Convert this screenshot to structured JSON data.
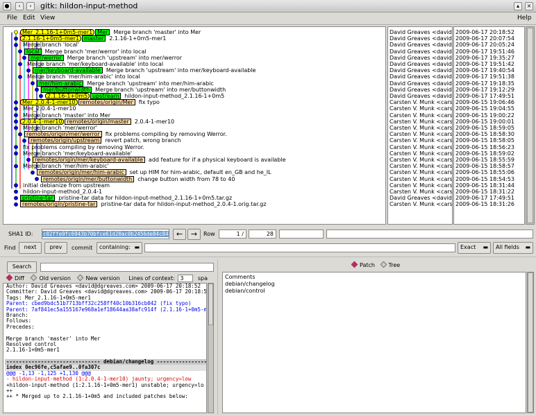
{
  "window": {
    "title": "gitk: hildon-input-method"
  },
  "menu": {
    "file": "File",
    "edit": "Edit",
    "view": "View",
    "help": "Help"
  },
  "commits": [
    {
      "refs": [
        {
          "label": "Mer_2.1.16-1+0m5-mer1",
          "kind": "tag"
        },
        {
          "label": "Mer",
          "kind": "head"
        }
      ],
      "msg": "Merge branch 'master' into Mer",
      "author": "David Greaves <david@",
      "date": "2009-06-17 20:18:52"
    },
    {
      "refs": [
        {
          "label": "2.1.16-1+0m5-mer1",
          "kind": "tag"
        },
        {
          "label": "master",
          "kind": "head"
        }
      ],
      "msg": "2.1.16-1+0m5-mer1",
      "author": "David Greaves <david@",
      "date": "2009-06-17 20:07:54"
    },
    {
      "refs": [],
      "msg": "Merge branch 'local'",
      "author": "David Greaves <david@",
      "date": "2009-06-17 20:05:24"
    },
    {
      "refs": [
        {
          "label": "local",
          "kind": "head"
        }
      ],
      "msg": "Merge branch 'mer/werror' into local",
      "author": "David Greaves <david@",
      "date": "2009-06-17 19:51:46"
    },
    {
      "refs": [
        {
          "label": "mer/werror",
          "kind": "head"
        }
      ],
      "msg": "Merge branch 'upstream' into mer/werror",
      "author": "David Greaves <david@",
      "date": "2009-06-17 19:35:27"
    },
    {
      "refs": [],
      "msg": "Merge branch 'mer/keyboard-available' into local",
      "author": "David Greaves <david@",
      "date": "2009-06-17 19:51:42"
    },
    {
      "refs": [
        {
          "label": "mer/keyboard-available",
          "kind": "head"
        }
      ],
      "msg": "Merge branch 'upstream' into mer/keyboard-available",
      "author": "David Greaves <david@",
      "date": "2009-06-17 19:40:54"
    },
    {
      "refs": [],
      "msg": "Merge branch 'mer/him-arabic' into local",
      "author": "David Greaves <david@",
      "date": "2009-06-17 19:51:38"
    },
    {
      "refs": [
        {
          "label": "mer/him-arabic",
          "kind": "head"
        }
      ],
      "msg": "Merge branch 'upstream' into mer/him-arabic",
      "author": "David Greaves <david@",
      "date": "2009-06-17 19:18:35"
    },
    {
      "refs": [
        {
          "label": "mer/buttonwidth",
          "kind": "head"
        }
      ],
      "msg": "Merge branch 'upstream' into mer/buttonwidth",
      "author": "David Greaves <david@",
      "date": "2009-06-17 19:12:29"
    },
    {
      "refs": [
        {
          "label": "2.1.16-1+0m5",
          "kind": "tag"
        },
        {
          "label": "upstream",
          "kind": "head"
        }
      ],
      "msg": "hildon-input-method_2.1.16-1+0m5",
      "author": "David Greaves <david@",
      "date": "2009-06-17 17:49:51"
    },
    {
      "refs": [
        {
          "label": "Mer_2.0.4-1-mer10",
          "kind": "tag"
        },
        {
          "label": "remotes/origin/Mer",
          "kind": "remote"
        }
      ],
      "msg": "fix typo",
      "author": "Carsten V. Munk <carste",
      "date": "2009-06-15 19:06:46"
    },
    {
      "refs": [],
      "msg": "Mer_2.0.4-1-mer10",
      "author": "Carsten V. Munk <carste",
      "date": "2009-06-15 19:04:55"
    },
    {
      "refs": [],
      "msg": "Merge branch 'master' into Mer",
      "author": "Carsten V. Munk <carste",
      "date": "2009-06-15 19:00:22"
    },
    {
      "refs": [
        {
          "label": "2.0.4-1-mer10",
          "kind": "tag"
        },
        {
          "label": "remotes/origin/master",
          "kind": "remote"
        }
      ],
      "msg": "2.0.4-1-mer10",
      "author": "Carsten V. Munk <carste",
      "date": "2009-06-15 19:00:01"
    },
    {
      "refs": [],
      "msg": "Merge branch 'mer/werror'",
      "author": "Carsten V. Munk <carste",
      "date": "2009-06-15 18:59:05"
    },
    {
      "refs": [
        {
          "label": "remotes/origin/mer/werror",
          "kind": "remote"
        }
      ],
      "msg": "fix problems compiling by removing Werror.",
      "author": "Carsten V. Munk <carste",
      "date": "2009-06-15 18:58:30"
    },
    {
      "refs": [
        {
          "label": "remotes/origin/upstream",
          "kind": "remote"
        }
      ],
      "msg": "revert patch, wrong branch",
      "author": "Carsten V. Munk <carste",
      "date": "2009-06-15 18:58:05"
    },
    {
      "refs": [],
      "msg": "fix problems compiling by removing Werror.",
      "author": "Carsten V. Munk <carste",
      "date": "2009-06-15 18:56:23"
    },
    {
      "refs": [],
      "msg": "Merge branch 'mer/keyboard-available'",
      "author": "Carsten V. Munk <carste",
      "date": "2009-06-15 18:59:02"
    },
    {
      "refs": [
        {
          "label": "remotes/origin/mer/keyboard-available",
          "kind": "remote"
        }
      ],
      "msg": "add feature for if a physical keyboard is available",
      "author": "Carsten V. Munk <carste",
      "date": "2009-06-15 18:55:59"
    },
    {
      "refs": [],
      "msg": "Merge branch 'mer/him-arabic'",
      "author": "Carsten V. Munk <carste",
      "date": "2009-06-15 18:58:57"
    },
    {
      "refs": [
        {
          "label": "remotes/origin/mer/him-arabic",
          "kind": "remote"
        }
      ],
      "msg": "set up HIM for him-arabic, default en_GB and he_IL",
      "author": "Carsten V. Munk <carste",
      "date": "2009-06-15 18:55:06"
    },
    {
      "refs": [
        {
          "label": "remotes/origin/mer/buttonwidth",
          "kind": "remote"
        }
      ],
      "msg": "change button width from 78 to 40",
      "author": "Carsten V. Munk <carste",
      "date": "2009-06-15 18:54:53"
    },
    {
      "refs": [],
      "msg": "initial debianize from upstream",
      "author": "Carsten V. Munk <carste",
      "date": "2009-06-15 18:31:44"
    },
    {
      "refs": [],
      "msg": "hildon-input-method_2.0.4-1",
      "author": "Carsten V. Munk <carste",
      "date": "2009-06-15 18:31:22"
    },
    {
      "refs": [
        {
          "label": "pristine-tar",
          "kind": "head"
        }
      ],
      "msg": "pristine-tar data for hildon-input-method_2.1.16-1+0m5.tar.gz",
      "author": "David Greaves <david@",
      "date": "2009-06-17 17:49:51"
    },
    {
      "refs": [
        {
          "label": "remotes/origin/pristine-tar",
          "kind": "remote"
        }
      ],
      "msg": "pristine-tar data for hildon-input-method_2.0.4-1.orig.tar.gz",
      "author": "Carsten V. Munk <carste",
      "date": "2009-06-15 18:31:26"
    }
  ],
  "sha": {
    "label": "SHA1 ID:",
    "value": "c02ffe9fc6943b70bfce61d20ac0b2456de84c84",
    "row_label": "Row",
    "row_current": "1",
    "row_total": "28"
  },
  "find": {
    "find": "Find",
    "next": "next",
    "prev": "prev",
    "commit": "commit",
    "containing": "containing:",
    "exact": "Exact",
    "fields": "All fields"
  },
  "search": {
    "button": "Search"
  },
  "diffopts": {
    "diff": "Diff",
    "old": "Old version",
    "new": "New version",
    "context_label": "Lines of context:",
    "context_value": "3",
    "spaces": "spa"
  },
  "diff_lines": [
    {
      "t": "Author: David Greaves <david@dgreaves.com>  2009-06-17 20:18:52",
      "c": "n"
    },
    {
      "t": "Committer: David Greaves <david@dgreaves.com>  2009-06-17 20:18:52",
      "c": "n"
    },
    {
      "t": "Tags: Mer_2.1.16-1+0m5-mer1",
      "c": "n"
    },
    {
      "t": "Parent: cbed9bdc51b7713bff32c258ff40c10b316cb042 (fix typo)",
      "c": "p"
    },
    {
      "t": "Parent: 7af841ec5a155167e968a1ef18644aa38afc914f (2.1.16-1+0m5-m",
      "c": "p"
    },
    {
      "t": "Branch:",
      "c": "n"
    },
    {
      "t": "Follows:",
      "c": "n"
    },
    {
      "t": "Precedes:",
      "c": "n"
    },
    {
      "t": "",
      "c": "n"
    },
    {
      "t": "    Merge branch 'master' into Mer",
      "c": "n"
    },
    {
      "t": "    Resolved control",
      "c": "n"
    },
    {
      "t": "    2.1.16-1+0m5-mer1",
      "c": "n"
    },
    {
      "t": "",
      "c": "n"
    },
    {
      "t": "------------------------------ debian/changelog -----------------",
      "c": "h"
    },
    {
      "t": "index 0ec96fe,c5afae9..0fa307c",
      "c": "i"
    },
    {
      "t": "@@@ -1,13 -1,125 +1,130 @@@",
      "c": "a"
    },
    {
      "t": "- hildon-input-method (1:2.0.4-1-mer10) jaunty; urgency=low",
      "c": "r"
    },
    {
      "t": " +hildon-input-method (1:2.1.16-1+0m5-mer1) unstable; urgency=lo",
      "c": "n"
    },
    {
      "t": "++",
      "c": "n"
    },
    {
      "t": "++  * Merged up to 2.1.16-1+0m5 and included patches below:",
      "c": "n"
    }
  ],
  "tabs": {
    "patch": "Patch",
    "tree": "Tree"
  },
  "files": [
    "Comments",
    "debian/changelog",
    "debian/control"
  ]
}
